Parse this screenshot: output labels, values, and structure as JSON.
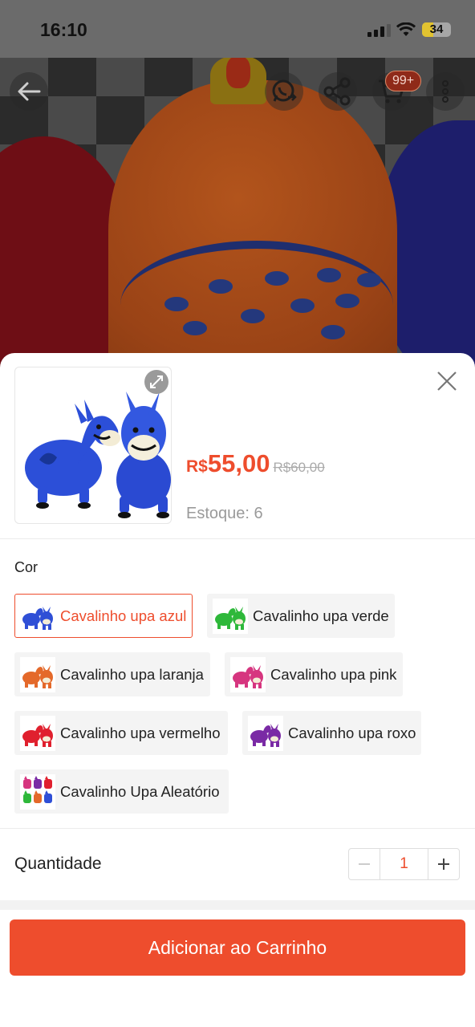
{
  "status_bar": {
    "time": "16:10",
    "battery": "34"
  },
  "header": {
    "cart_badge": "99+"
  },
  "product": {
    "currency": "R$",
    "price": "55,00",
    "old_price": "R$60,00",
    "stock": "Estoque: 6"
  },
  "variants": {
    "label": "Cor",
    "options": [
      {
        "label": "Cavalinho upa azul",
        "color": "#2f4fd6",
        "selected": true
      },
      {
        "label": "Cavalinho upa verde",
        "color": "#2eb83a",
        "selected": false
      },
      {
        "label": "Cavalinho upa laranja",
        "color": "#e4692a",
        "selected": false
      },
      {
        "label": "Cavalinho upa pink",
        "color": "#d6357f",
        "selected": false
      },
      {
        "label": "Cavalinho upa vermelho",
        "color": "#e0202e",
        "selected": false
      },
      {
        "label": "Cavalinho upa roxo",
        "color": "#7a2aa5",
        "selected": false
      },
      {
        "label": "Cavalinho Upa Aleatório",
        "color": "#c44a9a",
        "selected": false
      }
    ]
  },
  "quantity": {
    "label": "Quantidade",
    "value": "1"
  },
  "cta": {
    "label": "Adicionar ao Carrinho"
  },
  "colors": {
    "accent": "#ee4d2d"
  }
}
